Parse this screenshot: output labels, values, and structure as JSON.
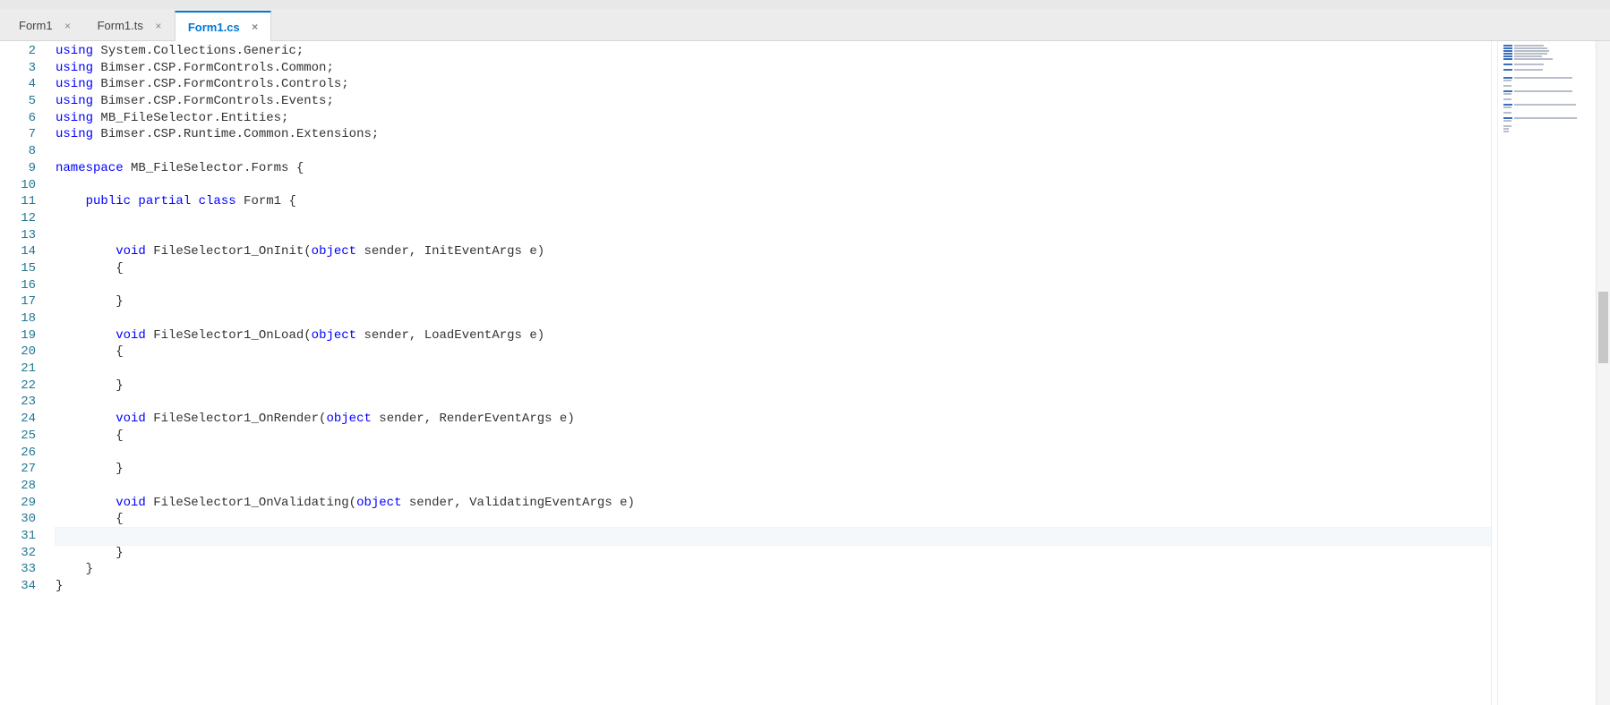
{
  "tabs": [
    {
      "label": "Form1",
      "active": false
    },
    {
      "label": "Form1.ts",
      "active": false
    },
    {
      "label": "Form1.cs",
      "active": true
    }
  ],
  "lineStart": 2,
  "currentLine": 31,
  "lines": [
    {
      "n": 2,
      "tokens": [
        [
          "kw",
          "using"
        ],
        [
          "ns",
          " System.Collections.Generic;"
        ]
      ]
    },
    {
      "n": 3,
      "tokens": [
        [
          "kw",
          "using"
        ],
        [
          "ns",
          " Bimser.CSP.FormControls.Common;"
        ]
      ]
    },
    {
      "n": 4,
      "tokens": [
        [
          "kw",
          "using"
        ],
        [
          "ns",
          " Bimser.CSP.FormControls.Controls;"
        ]
      ]
    },
    {
      "n": 5,
      "tokens": [
        [
          "kw",
          "using"
        ],
        [
          "ns",
          " Bimser.CSP.FormControls.Events;"
        ]
      ]
    },
    {
      "n": 6,
      "tokens": [
        [
          "kw",
          "using"
        ],
        [
          "ns",
          " MB_FileSelector.Entities;"
        ]
      ]
    },
    {
      "n": 7,
      "tokens": [
        [
          "kw",
          "using"
        ],
        [
          "ns",
          " Bimser.CSP.Runtime.Common.Extensions;"
        ]
      ]
    },
    {
      "n": 8,
      "tokens": []
    },
    {
      "n": 9,
      "tokens": [
        [
          "kw",
          "namespace"
        ],
        [
          "ns",
          " MB_FileSelector.Forms {"
        ]
      ]
    },
    {
      "n": 10,
      "tokens": []
    },
    {
      "n": 11,
      "tokens": [
        [
          "pad",
          "    "
        ],
        [
          "kw",
          "public partial class"
        ],
        [
          "ns",
          " Form1 {"
        ]
      ]
    },
    {
      "n": 12,
      "tokens": []
    },
    {
      "n": 13,
      "tokens": []
    },
    {
      "n": 14,
      "tokens": [
        [
          "pad",
          "        "
        ],
        [
          "kw",
          "void"
        ],
        [
          "ns",
          " FileSelector1_OnInit("
        ],
        [
          "kw",
          "object"
        ],
        [
          "ns",
          " sender, InitEventArgs e)"
        ]
      ]
    },
    {
      "n": 15,
      "tokens": [
        [
          "pad",
          "        "
        ],
        [
          "ns",
          "{"
        ]
      ]
    },
    {
      "n": 16,
      "tokens": []
    },
    {
      "n": 17,
      "tokens": [
        [
          "pad",
          "        "
        ],
        [
          "ns",
          "}"
        ]
      ]
    },
    {
      "n": 18,
      "tokens": []
    },
    {
      "n": 19,
      "tokens": [
        [
          "pad",
          "        "
        ],
        [
          "kw",
          "void"
        ],
        [
          "ns",
          " FileSelector1_OnLoad("
        ],
        [
          "kw",
          "object"
        ],
        [
          "ns",
          " sender, LoadEventArgs e)"
        ]
      ]
    },
    {
      "n": 20,
      "tokens": [
        [
          "pad",
          "        "
        ],
        [
          "ns",
          "{"
        ]
      ]
    },
    {
      "n": 21,
      "tokens": []
    },
    {
      "n": 22,
      "tokens": [
        [
          "pad",
          "        "
        ],
        [
          "ns",
          "}"
        ]
      ]
    },
    {
      "n": 23,
      "tokens": []
    },
    {
      "n": 24,
      "tokens": [
        [
          "pad",
          "        "
        ],
        [
          "kw",
          "void"
        ],
        [
          "ns",
          " FileSelector1_OnRender("
        ],
        [
          "kw",
          "object"
        ],
        [
          "ns",
          " sender, RenderEventArgs e)"
        ]
      ]
    },
    {
      "n": 25,
      "tokens": [
        [
          "pad",
          "        "
        ],
        [
          "ns",
          "{"
        ]
      ]
    },
    {
      "n": 26,
      "tokens": []
    },
    {
      "n": 27,
      "tokens": [
        [
          "pad",
          "        "
        ],
        [
          "ns",
          "}"
        ]
      ]
    },
    {
      "n": 28,
      "tokens": []
    },
    {
      "n": 29,
      "tokens": [
        [
          "pad",
          "        "
        ],
        [
          "kw",
          "void"
        ],
        [
          "ns",
          " FileSelector1_OnValidating("
        ],
        [
          "kw",
          "object"
        ],
        [
          "ns",
          " sender, ValidatingEventArgs e)"
        ]
      ]
    },
    {
      "n": 30,
      "tokens": [
        [
          "pad",
          "        "
        ],
        [
          "ns",
          "{"
        ]
      ]
    },
    {
      "n": 31,
      "tokens": []
    },
    {
      "n": 32,
      "tokens": [
        [
          "pad",
          "        "
        ],
        [
          "ns",
          "}"
        ]
      ]
    },
    {
      "n": 33,
      "tokens": [
        [
          "pad",
          "    "
        ],
        [
          "ns",
          "}"
        ]
      ]
    },
    {
      "n": 34,
      "tokens": [
        [
          "ns",
          "}"
        ]
      ]
    }
  ],
  "closeGlyph": "×"
}
